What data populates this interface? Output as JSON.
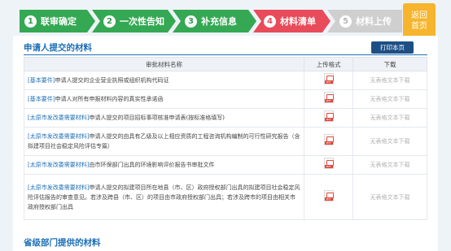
{
  "steps": [
    {
      "num": "1",
      "label": "联审确定",
      "state": "done"
    },
    {
      "num": "2",
      "label": "一次性告知",
      "state": "done"
    },
    {
      "num": "3",
      "label": "补充信息",
      "state": "done"
    },
    {
      "num": "4",
      "label": "材料清单",
      "state": "current"
    },
    {
      "num": "5",
      "label": "材料上传",
      "state": "todo"
    }
  ],
  "home": {
    "line1": "返回",
    "line2": "首页"
  },
  "applicant_section": {
    "title": "申请人提交的材料",
    "print_label": "打印本页"
  },
  "table": {
    "headers": [
      "审批材料名称",
      "上传格式",
      "下载"
    ],
    "rows": [
      {
        "tag": "[基本要件]",
        "text": "申请人提交的企业营业执照或组织机构代码证",
        "format": "PDF",
        "download": "无表格文本下载"
      },
      {
        "tag": "[基本要件]",
        "text": "申请人对所有申报材料内容的真实性承诺函",
        "format": "PDF",
        "download": "无表格文本下载"
      },
      {
        "tag": "[太原市发改委需要材料]",
        "text": "申请人提交的项目招标事项核准申请表(按标准格填写)",
        "format": "PDF",
        "download": "无表格文本下载"
      },
      {
        "tag": "[太原市发改委需要材料]",
        "text": "申请人提交的由具有乙级及以上相应资质的工程咨询机构编制的可行性研究报告（含拟建项目社会稳定风险评估专篇）",
        "format": "PDF",
        "download": "无表格文本下载"
      },
      {
        "tag": "[太原市发改委需要材料]",
        "text": "由市环保部门出具的环境影响评价报告书审批文件",
        "format": "PDF",
        "download": "无表格文本下载"
      },
      {
        "tag": "[太原市发改委需要材料]",
        "text": "申请人提交的拟建项目所在地县（市、区）政府授权部门出具的拟建项目社会稳定风险评估报告的审查意见。若涉及跨县（市、区）的项目由市政府授权部门出具；若涉及跨市的项目由相关市政府授权部门出具",
        "format": "PDF",
        "download": "无表格文本下载"
      }
    ]
  },
  "provincial_section": {
    "title": "省级部门提供的材料"
  }
}
